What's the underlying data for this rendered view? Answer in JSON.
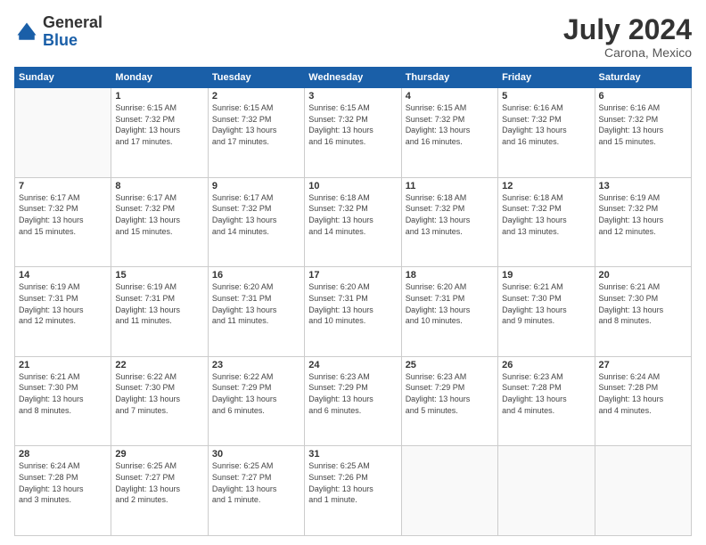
{
  "logo": {
    "text_general": "General",
    "text_blue": "Blue"
  },
  "title": "July 2024",
  "location": "Carona, Mexico",
  "days_of_week": [
    "Sunday",
    "Monday",
    "Tuesday",
    "Wednesday",
    "Thursday",
    "Friday",
    "Saturday"
  ],
  "weeks": [
    [
      {
        "day": "",
        "info": ""
      },
      {
        "day": "1",
        "info": "Sunrise: 6:15 AM\nSunset: 7:32 PM\nDaylight: 13 hours\nand 17 minutes."
      },
      {
        "day": "2",
        "info": "Sunrise: 6:15 AM\nSunset: 7:32 PM\nDaylight: 13 hours\nand 17 minutes."
      },
      {
        "day": "3",
        "info": "Sunrise: 6:15 AM\nSunset: 7:32 PM\nDaylight: 13 hours\nand 16 minutes."
      },
      {
        "day": "4",
        "info": "Sunrise: 6:15 AM\nSunset: 7:32 PM\nDaylight: 13 hours\nand 16 minutes."
      },
      {
        "day": "5",
        "info": "Sunrise: 6:16 AM\nSunset: 7:32 PM\nDaylight: 13 hours\nand 16 minutes."
      },
      {
        "day": "6",
        "info": "Sunrise: 6:16 AM\nSunset: 7:32 PM\nDaylight: 13 hours\nand 15 minutes."
      }
    ],
    [
      {
        "day": "7",
        "info": ""
      },
      {
        "day": "8",
        "info": "Sunrise: 6:17 AM\nSunset: 7:32 PM\nDaylight: 13 hours\nand 15 minutes."
      },
      {
        "day": "9",
        "info": "Sunrise: 6:17 AM\nSunset: 7:32 PM\nDaylight: 13 hours\nand 14 minutes."
      },
      {
        "day": "10",
        "info": "Sunrise: 6:18 AM\nSunset: 7:32 PM\nDaylight: 13 hours\nand 14 minutes."
      },
      {
        "day": "11",
        "info": "Sunrise: 6:18 AM\nSunset: 7:32 PM\nDaylight: 13 hours\nand 13 minutes."
      },
      {
        "day": "12",
        "info": "Sunrise: 6:18 AM\nSunset: 7:32 PM\nDaylight: 13 hours\nand 13 minutes."
      },
      {
        "day": "13",
        "info": "Sunrise: 6:19 AM\nSunset: 7:32 PM\nDaylight: 13 hours\nand 12 minutes."
      }
    ],
    [
      {
        "day": "14",
        "info": ""
      },
      {
        "day": "15",
        "info": "Sunrise: 6:19 AM\nSunset: 7:31 PM\nDaylight: 13 hours\nand 11 minutes."
      },
      {
        "day": "16",
        "info": "Sunrise: 6:20 AM\nSunset: 7:31 PM\nDaylight: 13 hours\nand 11 minutes."
      },
      {
        "day": "17",
        "info": "Sunrise: 6:20 AM\nSunset: 7:31 PM\nDaylight: 13 hours\nand 10 minutes."
      },
      {
        "day": "18",
        "info": "Sunrise: 6:20 AM\nSunset: 7:31 PM\nDaylight: 13 hours\nand 10 minutes."
      },
      {
        "day": "19",
        "info": "Sunrise: 6:21 AM\nSunset: 7:30 PM\nDaylight: 13 hours\nand 9 minutes."
      },
      {
        "day": "20",
        "info": "Sunrise: 6:21 AM\nSunset: 7:30 PM\nDaylight: 13 hours\nand 8 minutes."
      }
    ],
    [
      {
        "day": "21",
        "info": ""
      },
      {
        "day": "22",
        "info": "Sunrise: 6:22 AM\nSunset: 7:30 PM\nDaylight: 13 hours\nand 7 minutes."
      },
      {
        "day": "23",
        "info": "Sunrise: 6:22 AM\nSunset: 7:29 PM\nDaylight: 13 hours\nand 6 minutes."
      },
      {
        "day": "24",
        "info": "Sunrise: 6:23 AM\nSunset: 7:29 PM\nDaylight: 13 hours\nand 6 minutes."
      },
      {
        "day": "25",
        "info": "Sunrise: 6:23 AM\nSunset: 7:29 PM\nDaylight: 13 hours\nand 5 minutes."
      },
      {
        "day": "26",
        "info": "Sunrise: 6:23 AM\nSunset: 7:28 PM\nDaylight: 13 hours\nand 4 minutes."
      },
      {
        "day": "27",
        "info": "Sunrise: 6:24 AM\nSunset: 7:28 PM\nDaylight: 13 hours\nand 4 minutes."
      }
    ],
    [
      {
        "day": "28",
        "info": "Sunrise: 6:24 AM\nSunset: 7:28 PM\nDaylight: 13 hours\nand 3 minutes."
      },
      {
        "day": "29",
        "info": "Sunrise: 6:25 AM\nSunset: 7:27 PM\nDaylight: 13 hours\nand 2 minutes."
      },
      {
        "day": "30",
        "info": "Sunrise: 6:25 AM\nSunset: 7:27 PM\nDaylight: 13 hours\nand 1 minute."
      },
      {
        "day": "31",
        "info": "Sunrise: 6:25 AM\nSunset: 7:26 PM\nDaylight: 13 hours\nand 1 minute."
      },
      {
        "day": "",
        "info": ""
      },
      {
        "day": "",
        "info": ""
      },
      {
        "day": "",
        "info": ""
      }
    ]
  ],
  "week7_sunday": "Sunrise: 6:17 AM\nSunset: 7:32 PM\nDaylight: 13 hours\nand 15 minutes.",
  "week14_sunday": "Sunrise: 6:19 AM\nSunset: 7:31 PM\nDaylight: 13 hours\nand 12 minutes.",
  "week21_sunday": "Sunrise: 6:21 AM\nSunset: 7:30 PM\nDaylight: 13 hours\nand 8 minutes."
}
